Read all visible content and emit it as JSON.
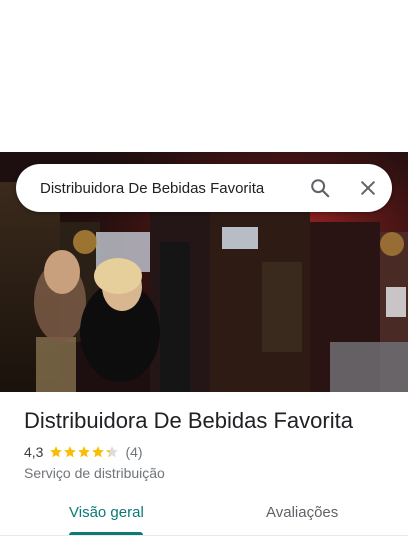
{
  "search": {
    "query": "Distribuidora De Bebidas Favorita"
  },
  "place": {
    "name": "Distribuidora De Bebidas Favorita",
    "rating": "4,3",
    "stars": 4.3,
    "review_count": "(4)",
    "category": "Serviço de distribuição"
  },
  "tabs": [
    {
      "label": "Visão geral",
      "selected": true
    },
    {
      "label": "Avaliações",
      "selected": false
    }
  ],
  "colors": {
    "accent": "#0b7a75",
    "star": "#fbbc04",
    "star_empty": "#dadce0"
  },
  "icons": [
    "search-icon",
    "close-icon",
    "star-icon"
  ]
}
